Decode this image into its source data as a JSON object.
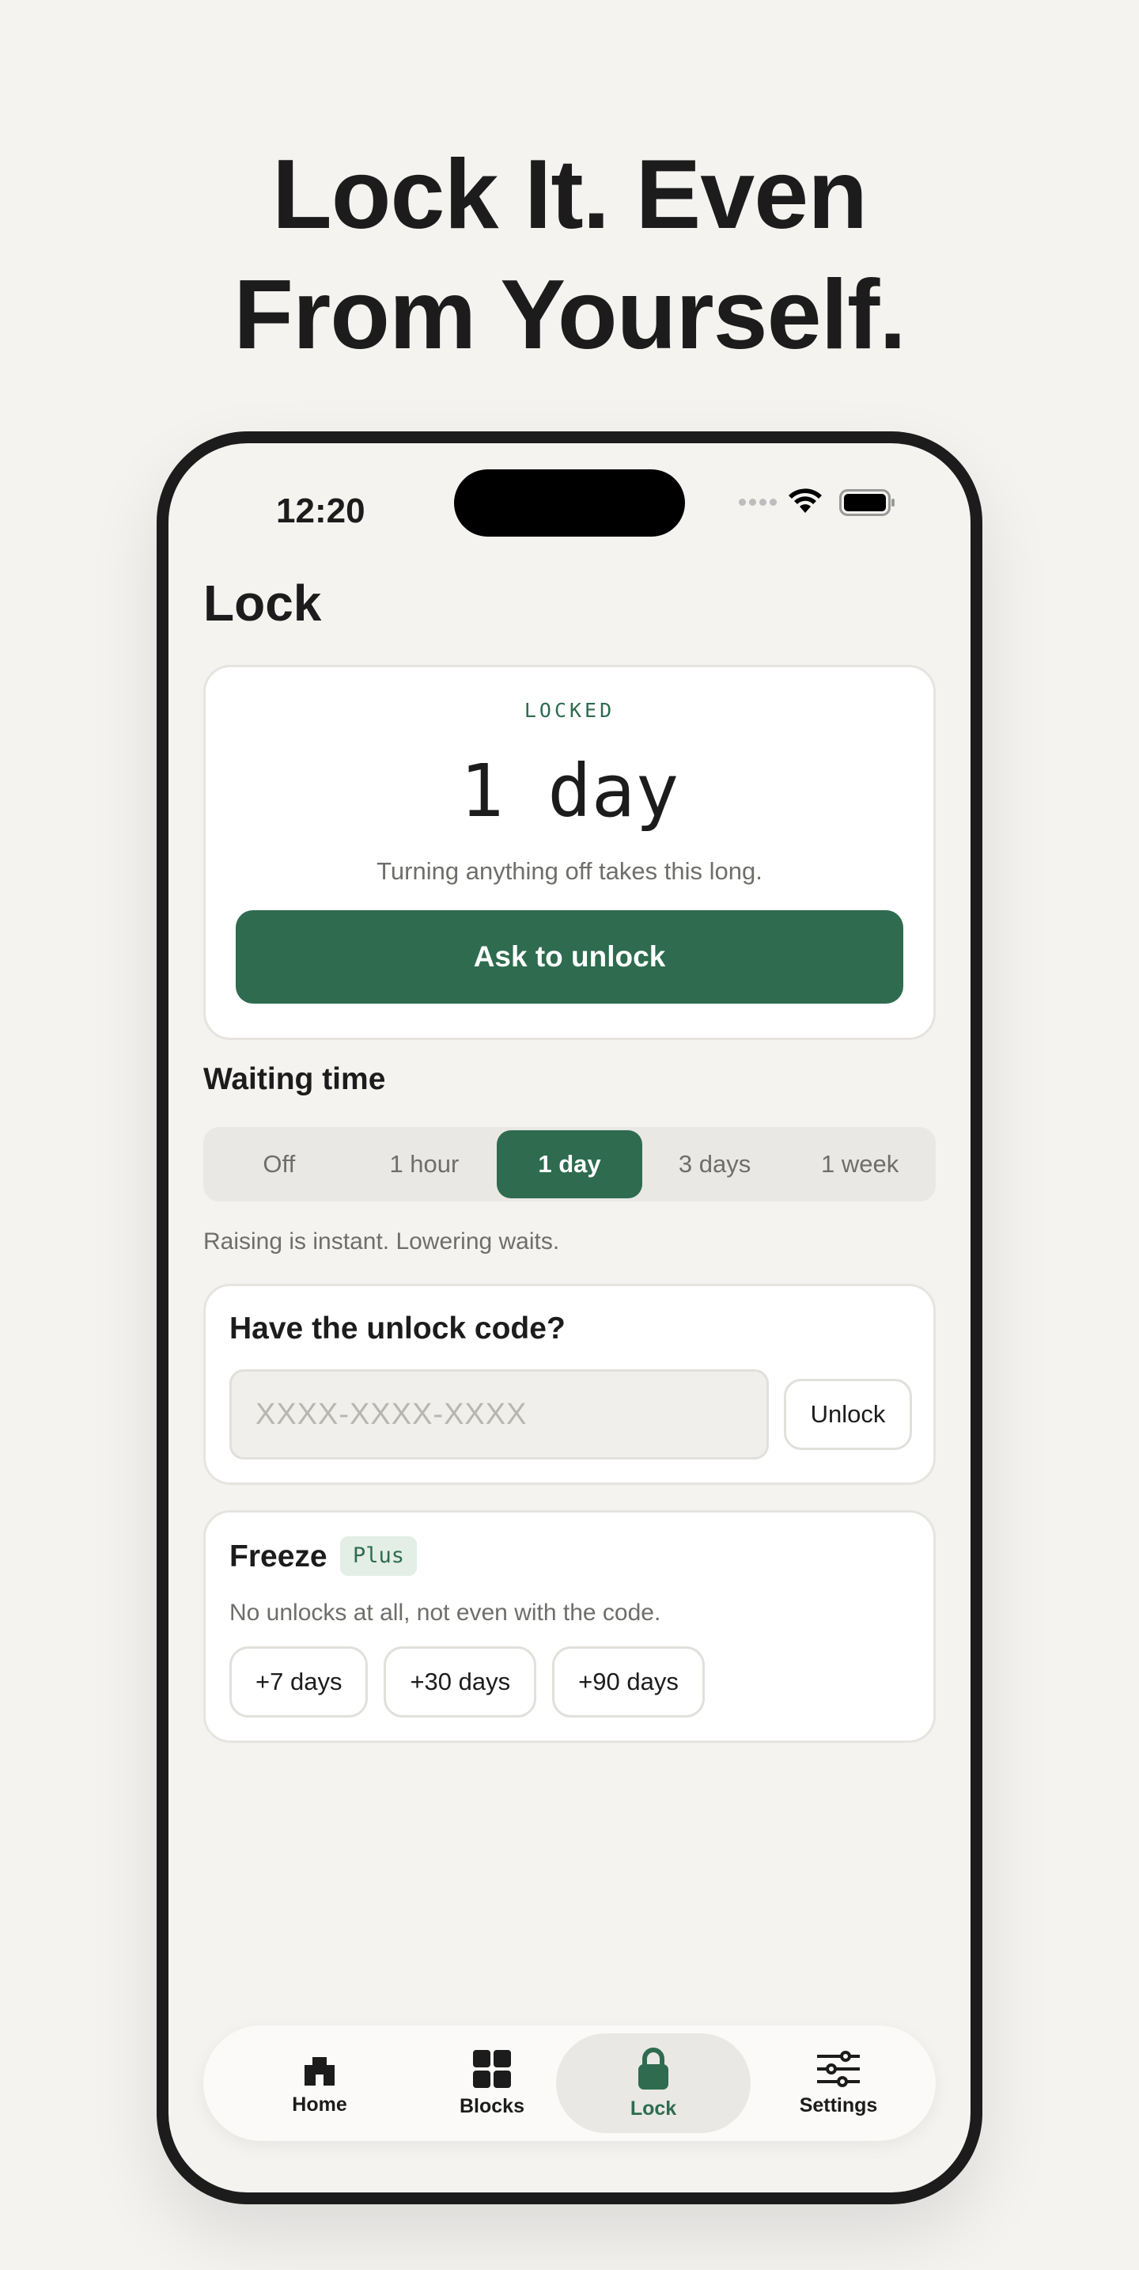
{
  "headline": {
    "line1": "Lock It. Even",
    "line2": "From Yourself."
  },
  "status_bar": {
    "time": "12:20"
  },
  "page": {
    "title": "Lock"
  },
  "lock_card": {
    "status": "LOCKED",
    "duration": "1 day",
    "description": "Turning anything off takes this long.",
    "button_label": "Ask to unlock"
  },
  "waiting_time": {
    "title": "Waiting time",
    "options": [
      "Off",
      "1 hour",
      "1 day",
      "3 days",
      "1 week"
    ],
    "selected": "1 day",
    "note": "Raising is instant. Lowering waits."
  },
  "unlock_code": {
    "title": "Have the unlock code?",
    "placeholder": "XXXX-XXXX-XXXX",
    "value": "",
    "button_label": "Unlock"
  },
  "freeze": {
    "title": "Freeze",
    "badge": "Plus",
    "description": "No unlocks at all, not even with the code.",
    "options": [
      "+7 days",
      "+30 days",
      "+90 days"
    ]
  },
  "tab_bar": {
    "items": [
      {
        "label": "Home",
        "icon": "home-icon"
      },
      {
        "label": "Blocks",
        "icon": "grid-icon"
      },
      {
        "label": "Lock",
        "icon": "lock-icon"
      },
      {
        "label": "Settings",
        "icon": "sliders-icon"
      }
    ],
    "active": "Lock"
  },
  "colors": {
    "accent": "#2e6b4f",
    "background": "#f4f3f0",
    "text": "#1c1c1c",
    "muted": "#6e6e6a"
  }
}
